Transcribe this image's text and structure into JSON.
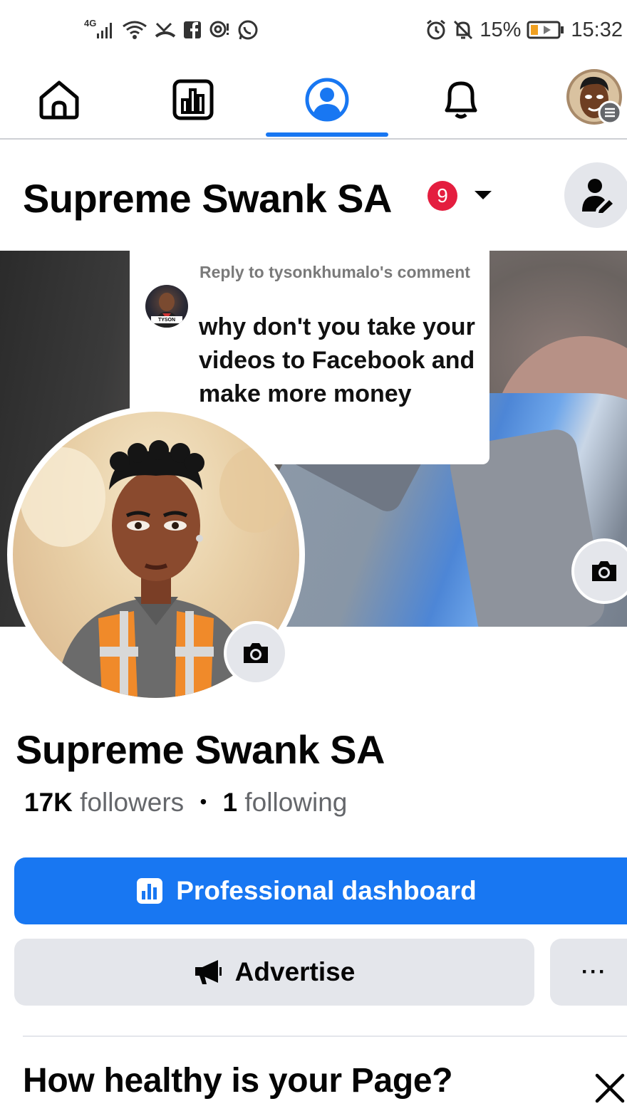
{
  "status_bar": {
    "network": "4G",
    "battery_percent": "15%",
    "time": "15:32"
  },
  "nav": {
    "tabs": [
      {
        "name": "home",
        "icon": "home-icon"
      },
      {
        "name": "dashboard",
        "icon": "bar-chart-icon"
      },
      {
        "name": "profile",
        "icon": "profile-icon",
        "active": true
      },
      {
        "name": "notifications",
        "icon": "bell-icon"
      },
      {
        "name": "menu",
        "icon": "avatar-menu-icon"
      }
    ]
  },
  "header": {
    "page_name": "Supreme Swank SA",
    "notification_count": "9"
  },
  "reply_overlay": {
    "heading": "Reply to tysonkhumalo's comment",
    "avatar_tag": "TYSON",
    "text": "why don't you take your videos to Facebook and make more money"
  },
  "profile": {
    "name": "Supreme Swank SA",
    "followers_count": "17K",
    "followers_label": "followers",
    "separator": "•",
    "following_count": "1",
    "following_label": "following"
  },
  "actions": {
    "dashboard_label": "Professional dashboard",
    "advertise_label": "Advertise",
    "more_label": "···"
  },
  "health": {
    "title": "How healthy is your Page?"
  },
  "colors": {
    "accent": "#1877f2",
    "badge": "#e41e3f",
    "secondary_button": "#e4e6eb"
  }
}
